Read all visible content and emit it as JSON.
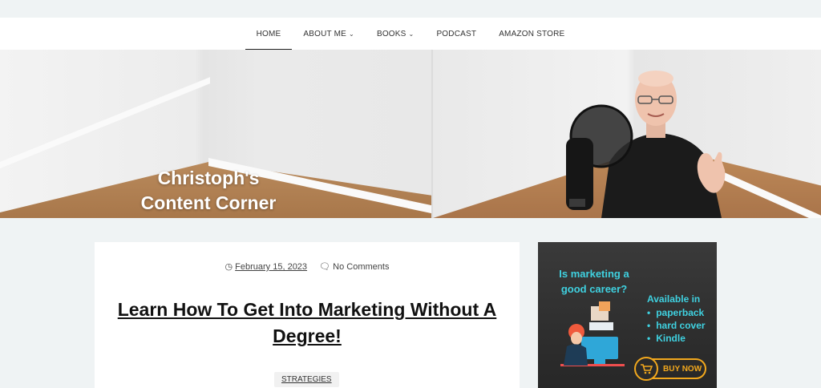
{
  "nav": {
    "items": [
      {
        "label": "HOME",
        "active": true,
        "dropdown": false
      },
      {
        "label": "ABOUT ME",
        "active": false,
        "dropdown": true
      },
      {
        "label": "BOOKS",
        "active": false,
        "dropdown": true
      },
      {
        "label": "PODCAST",
        "active": false,
        "dropdown": false
      },
      {
        "label": "AMAZON STORE",
        "active": false,
        "dropdown": false
      }
    ]
  },
  "hero": {
    "title_line1": "Christoph's",
    "title_line2": "Content Corner"
  },
  "post": {
    "date": "February 15, 2023",
    "comments": "No Comments",
    "title": "Learn How To Get Into Marketing Without A Degree!",
    "category": "STRATEGIES"
  },
  "ad": {
    "question_line1": "Is marketing a",
    "question_line2": "good career?",
    "available": "Available in",
    "formats": [
      "paperback",
      "hard cover",
      "Kindle"
    ],
    "buy_label": "BUY NOW",
    "accent_color": "#3fd1e0",
    "button_color": "#f2a81d"
  }
}
